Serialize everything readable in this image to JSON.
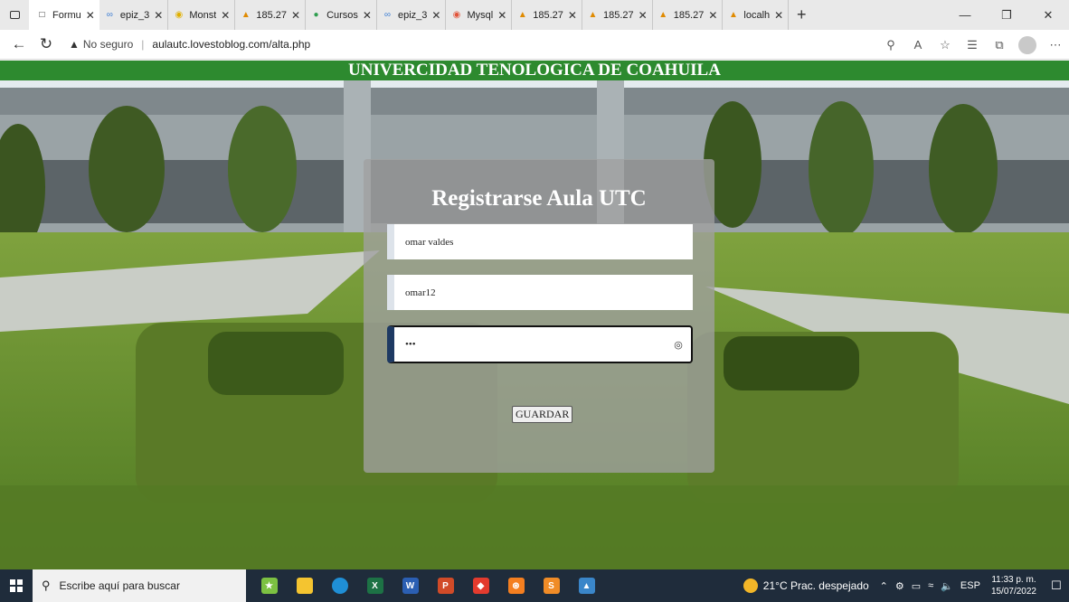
{
  "browser": {
    "tabs": [
      {
        "title": "Formu",
        "icon": "page-icon",
        "active": true
      },
      {
        "title": "epiz_3",
        "icon": "infinity-icon"
      },
      {
        "title": "Monst",
        "icon": "monster-icon"
      },
      {
        "title": "185.27",
        "icon": "server-icon"
      },
      {
        "title": "Cursos",
        "icon": "course-icon"
      },
      {
        "title": "epiz_3",
        "icon": "infinity-icon"
      },
      {
        "title": "Mysql",
        "icon": "mysql-icon"
      },
      {
        "title": "185.27",
        "icon": "server-icon"
      },
      {
        "title": "185.27",
        "icon": "server-icon"
      },
      {
        "title": "185.27",
        "icon": "server-icon"
      },
      {
        "title": "localh",
        "icon": "server-icon"
      }
    ],
    "address": {
      "security_label": "No seguro",
      "url": "aulautc.lovestoblog.com/alta.php"
    }
  },
  "page": {
    "banner": "UNIVERCIDAD TENOLOGICA DE COAHUILA",
    "form": {
      "title": "Registrarse Aula UTC",
      "name_value": "omar valdes",
      "user_value": "omar12",
      "password_masked": "•••",
      "submit_label": "GUARDAR"
    }
  },
  "taskbar": {
    "search_placeholder": "Escribe aquí para buscar",
    "weather": "21°C  Prac. despejado",
    "language": "ESP",
    "time": "11:33 p. m.",
    "date": "15/07/2022"
  },
  "colors": {
    "banner_green": "#2d8a2f",
    "taskbar": "#1f2c3b",
    "card": "#a0a0a0"
  }
}
